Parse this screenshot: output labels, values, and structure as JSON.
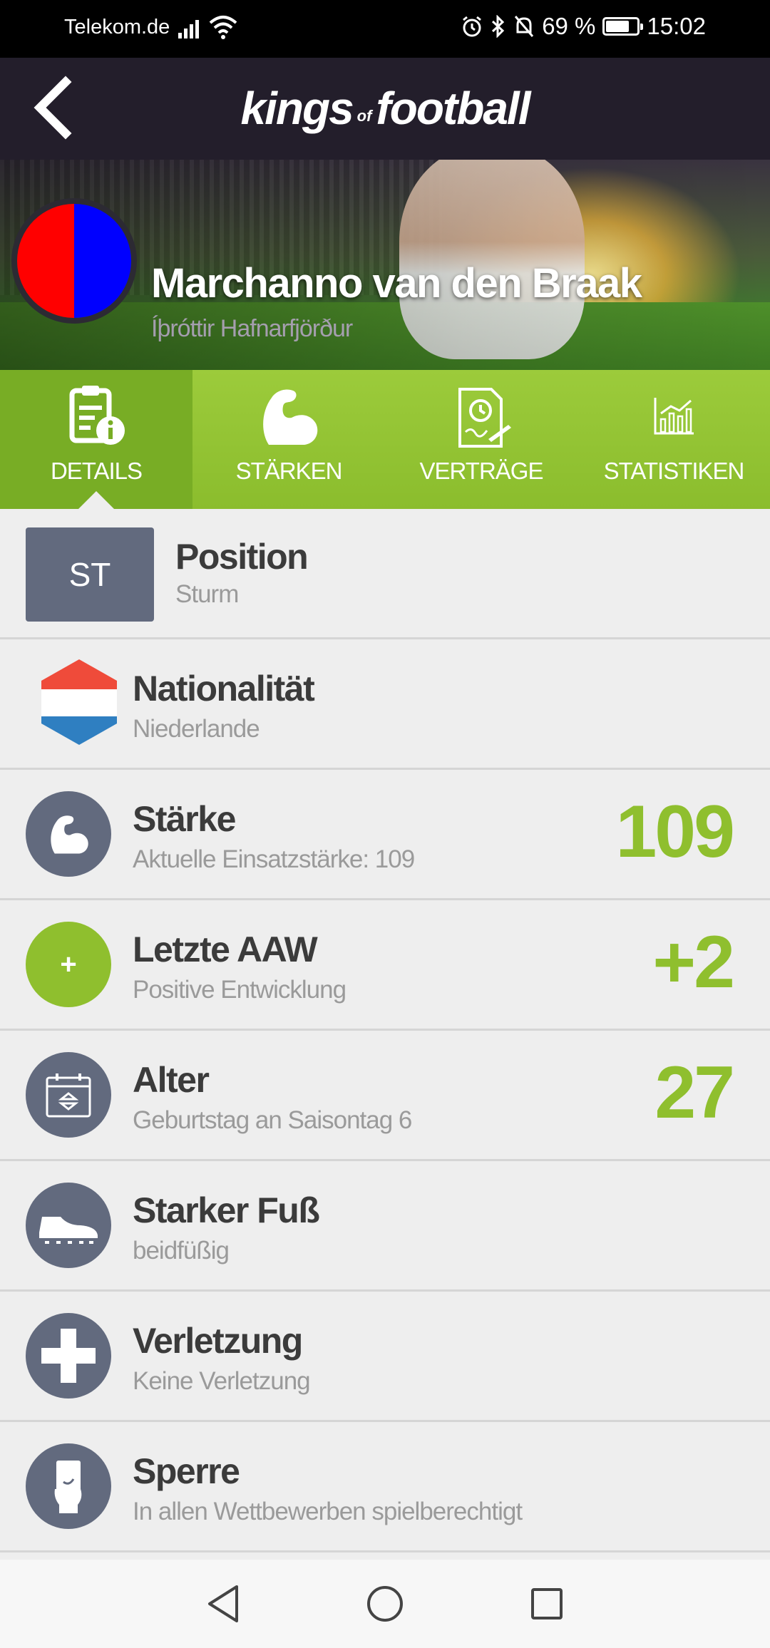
{
  "status_bar": {
    "carrier": "Telekom.de",
    "battery": "69 %",
    "battery_level": 0.69,
    "time": "15:02"
  },
  "app_bar": {
    "logo_kings": "kings",
    "logo_of": "of",
    "logo_football": "football"
  },
  "player": {
    "name": "Marchanno van den Braak",
    "club": "Íþróttir Hafnarfjörður",
    "club_colors": [
      "#ff0000",
      "#0000ff"
    ]
  },
  "tabs": [
    {
      "label": "DETAILS",
      "icon": "details-icon",
      "active": true
    },
    {
      "label": "STÄRKEN",
      "icon": "bicep-icon",
      "active": false
    },
    {
      "label": "VERTRÄGE",
      "icon": "contract-icon",
      "active": false
    },
    {
      "label": "STATISTIKEN",
      "icon": "chart-icon",
      "active": false
    }
  ],
  "details": {
    "position": {
      "badge": "ST",
      "title": "Position",
      "sub": "Sturm"
    },
    "nationality": {
      "title": "Nationalität",
      "sub": "Niederlande",
      "flag_colors": [
        "#ef4b3a",
        "#ffffff",
        "#2f7fc1"
      ]
    },
    "strength": {
      "title": "Stärke",
      "sub": "Aktuelle Einsatzstärke: 109",
      "value": "109",
      "icon": "bicep-icon"
    },
    "last_aaw": {
      "title": "Letzte AAW",
      "sub": "Positive Entwicklung",
      "value": "+2",
      "icon_text": "+"
    },
    "age": {
      "title": "Alter",
      "sub": "Geburtstag an Saisontag 6",
      "value": "27",
      "icon": "calendar-icon"
    },
    "foot": {
      "title": "Starker Fuß",
      "sub": "beidfüßig",
      "icon": "boot-icon"
    },
    "injury": {
      "title": "Verletzung",
      "sub": "Keine Verletzung",
      "icon": "medical-cross-icon"
    },
    "suspension": {
      "title": "Sperre",
      "sub": "In allen Wettbewerben spielberechtigt",
      "icon": "referee-card-icon"
    }
  },
  "colors": {
    "accent_green": "#8fbf2e",
    "icon_slate": "#626a7e",
    "app_bar": "#231e2b"
  }
}
